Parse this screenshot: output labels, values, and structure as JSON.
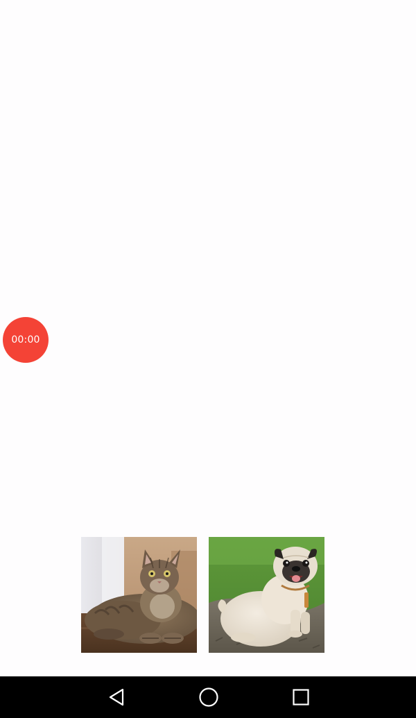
{
  "timer": {
    "label": "00:00",
    "color": "#f44336"
  },
  "choices": [
    {
      "name": "cat",
      "icon": "cat-photo"
    },
    {
      "name": "dog",
      "icon": "pug-photo"
    }
  ],
  "navbar": {
    "back_icon": "back-triangle-icon",
    "home_icon": "home-circle-icon",
    "recents_icon": "recents-square-icon"
  }
}
